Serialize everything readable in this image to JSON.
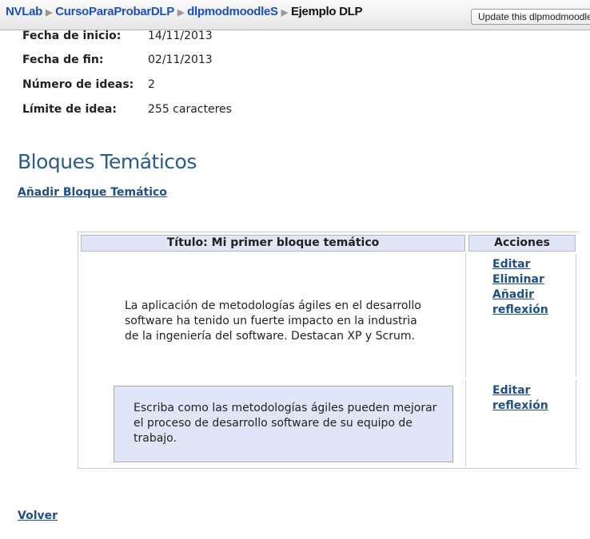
{
  "breadcrumb": {
    "items": [
      "NVLab",
      "CursoParaProbarDLP",
      "dlpmodmoodleS"
    ],
    "current": "Ejemplo DLP"
  },
  "update_button": "Update this dlpmodmoodleS",
  "fields": [
    {
      "label": "Fecha de inicio:",
      "value": "14/11/2013"
    },
    {
      "label": "Fecha de fin:",
      "value": "02/11/2013"
    },
    {
      "label": "Número de ideas:",
      "value": "2"
    },
    {
      "label": "Límite de idea:",
      "value": "255 caracteres"
    }
  ],
  "section_title": "Bloques Temáticos",
  "add_block_link": "Añadir Bloque Temático",
  "table": {
    "title_header": "Título: Mi primer bloque temático",
    "actions_header": "Acciones",
    "block_text": "La aplicación de metodologías ágiles en el desarrollo software ha tenido un fuerte impacto en la industria de la ingeniería del software. Destacan XP y Scrum.",
    "block_actions": [
      "Editar",
      "Eliminar",
      "Añadir reflexión"
    ],
    "reflection_text": "Escriba como las metodologías ágiles pueden mejorar el proceso de desarrollo software de su equipo de trabajo.",
    "reflection_actions": [
      "Editar reflexión"
    ]
  },
  "back_link": "Volver"
}
